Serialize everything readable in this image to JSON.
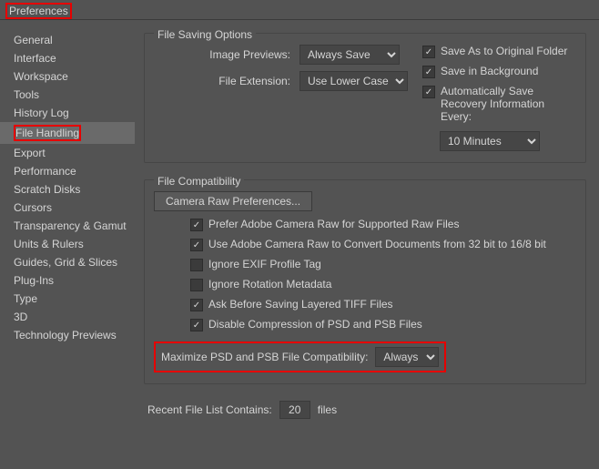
{
  "window": {
    "title": "Preferences"
  },
  "sidebar": {
    "items": [
      {
        "label": "General"
      },
      {
        "label": "Interface"
      },
      {
        "label": "Workspace"
      },
      {
        "label": "Tools"
      },
      {
        "label": "History Log"
      },
      {
        "label": "File Handling",
        "selected": true,
        "highlighted": true
      },
      {
        "label": "Export"
      },
      {
        "label": "Performance"
      },
      {
        "label": "Scratch Disks"
      },
      {
        "label": "Cursors"
      },
      {
        "label": "Transparency & Gamut"
      },
      {
        "label": "Units & Rulers"
      },
      {
        "label": "Guides, Grid & Slices"
      },
      {
        "label": "Plug-Ins"
      },
      {
        "label": "Type"
      },
      {
        "label": "3D"
      },
      {
        "label": "Technology Previews"
      }
    ]
  },
  "file_saving": {
    "group_title": "File Saving Options",
    "image_previews_label": "Image Previews:",
    "image_previews_value": "Always Save",
    "file_extension_label": "File Extension:",
    "file_extension_value": "Use Lower Case",
    "save_original_label": "Save As to Original Folder",
    "save_background_label": "Save in Background",
    "auto_recovery_label": "Automatically Save Recovery Information Every:",
    "recovery_interval_value": "10 Minutes"
  },
  "file_compat": {
    "group_title": "File Compatibility",
    "camera_raw_btn": "Camera Raw Preferences...",
    "prefer_acr_label": "Prefer Adobe Camera Raw for Supported Raw Files",
    "use_acr_convert_label": "Use Adobe Camera Raw to Convert Documents from 32 bit to 16/8 bit",
    "ignore_exif_label": "Ignore EXIF Profile Tag",
    "ignore_rotation_label": "Ignore Rotation Metadata",
    "ask_tiff_label": "Ask Before Saving Layered TIFF Files",
    "disable_compression_label": "Disable Compression of PSD and PSB Files",
    "maximize_compat_label": "Maximize PSD and PSB File Compatibility:",
    "maximize_compat_value": "Always"
  },
  "recent": {
    "label": "Recent File List Contains:",
    "value": "20",
    "suffix": "files"
  }
}
